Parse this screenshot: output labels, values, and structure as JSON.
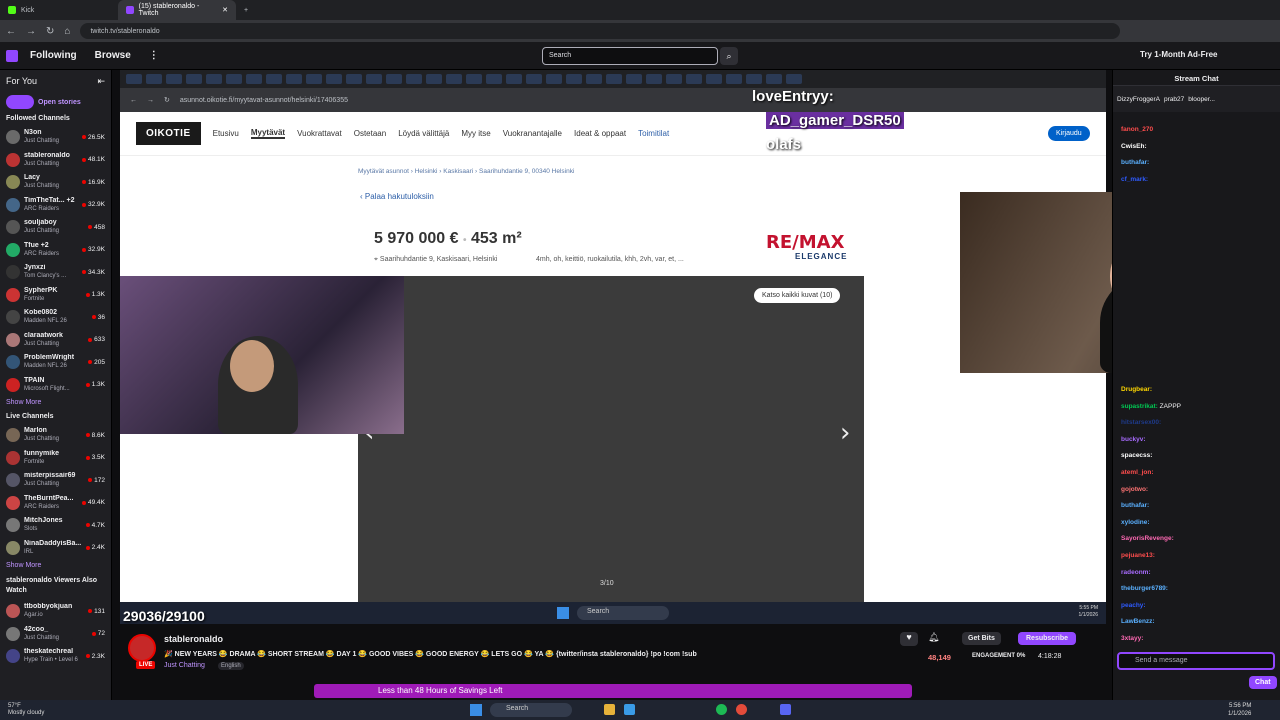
{
  "browser": {
    "tabs": [
      {
        "label": "Kick",
        "active": false,
        "color": "#53fc18"
      },
      {
        "label": "(15) stableronaldo - Twitch",
        "active": true,
        "color": "#9147ff"
      }
    ],
    "url": "twitch.tv/stableronaldo"
  },
  "twitch_nav": {
    "following": "Following",
    "browse": "Browse",
    "search_placeholder": "Search",
    "ad_free": "Try 1-Month Ad-Free"
  },
  "sidebar": {
    "for_you": "For You",
    "open_stories": "Open stories",
    "followed_title": "Followed Channels",
    "followed": [
      {
        "name": "N3on",
        "game": "Just Chatting",
        "viewers": "26.5K",
        "color": "#6a6a6a"
      },
      {
        "name": "stableronaldo",
        "game": "Just Chatting",
        "viewers": "48.1K",
        "color": "#b33"
      },
      {
        "name": "Lacy",
        "game": "Just Chatting",
        "viewers": "16.9K",
        "color": "#885"
      },
      {
        "name": "TimTheTat... +2",
        "game": "ARC Raiders",
        "viewers": "32.9K",
        "color": "#468"
      },
      {
        "name": "souljaboy",
        "game": "Just Chatting",
        "viewers": "458",
        "color": "#555"
      },
      {
        "name": "Tfue +2",
        "game": "ARC Raiders",
        "viewers": "32.9K",
        "color": "#2a6"
      },
      {
        "name": "Jynxzi",
        "game": "Tom Clancy's ...",
        "viewers": "34.3K",
        "color": "#333"
      },
      {
        "name": "SypherPK",
        "game": "Fortnite",
        "viewers": "1.3K",
        "color": "#c33"
      },
      {
        "name": "Kobe0802",
        "game": "Madden NFL 26",
        "viewers": "36",
        "color": "#444"
      },
      {
        "name": "claraatwork",
        "game": "Just Chatting",
        "viewers": "633",
        "color": "#a77"
      },
      {
        "name": "ProblemWright",
        "game": "Madden NFL 26",
        "viewers": "205",
        "color": "#357"
      },
      {
        "name": "TPAIN",
        "game": "Microsoft Flight...",
        "viewers": "1.3K",
        "color": "#c22"
      }
    ],
    "show_more_1": "Show More",
    "live_title": "Live Channels",
    "live": [
      {
        "name": "Marlon",
        "game": "Just Chatting",
        "viewers": "8.6K",
        "color": "#765"
      },
      {
        "name": "funnymike",
        "game": "Fortnite",
        "viewers": "3.5K",
        "color": "#a33"
      },
      {
        "name": "misterpissair69",
        "game": "Just Chatting",
        "viewers": "172",
        "color": "#556"
      },
      {
        "name": "TheBurntPea...",
        "game": "ARC Raiders",
        "viewers": "49.4K",
        "color": "#c44"
      },
      {
        "name": "MitchJones",
        "game": "Slots",
        "viewers": "4.7K",
        "color": "#777"
      },
      {
        "name": "NinaDaddyisBa...",
        "game": "IRL",
        "viewers": "2.4K",
        "color": "#886"
      }
    ],
    "show_more_2": "Show More",
    "viewers_watch_title": "stableronaldo Viewers Also Watch",
    "also_watch": [
      {
        "name": "ttbobbyokjuan",
        "game": "Agar.io",
        "viewers": "131",
        "color": "#b55"
      },
      {
        "name": "42coo_",
        "game": "Just Chatting",
        "viewers": "72",
        "color": "#777"
      },
      {
        "name": "theskatechreal",
        "game": "Hype Train • Level 6",
        "viewers": "2.3K",
        "color": "#448"
      }
    ]
  },
  "stream_page": {
    "inner_url": "asunnot.oikotie.fi/myytavat-asunnot/helsinki/17406355",
    "logo": "OIKOTIE",
    "nav": [
      "Etusivu",
      "Myytävät",
      "Vuokrattavat",
      "Ostetaan",
      "Löydä välittäjä",
      "Myy itse",
      "Vuokranantajalle",
      "Ideat & oppaat",
      "Toimitilat"
    ],
    "login": "Kirjaudu",
    "breadcrumb": "Myytävät asunnot › Helsinki › Kaskisaari › Saarihuhdantie 9, 00340 Helsinki",
    "back": "Palaa hakutuloksiin",
    "price": "5 970 000 €",
    "area": "453 m²",
    "address": "Saarihuhdantie 9, Kaskisaari, Helsinki",
    "rooms": "4mh, oh, keittiö, ruokailutila, khh, 2vh, var, et, ...",
    "agency": "RE/MAX",
    "agency_sub": "ELEGANCE",
    "see_all": "Katso kaikki kuvat (10)",
    "counter": "3/10",
    "inner_search": "Search",
    "inner_time": "5:55 PM",
    "inner_date": "1/1/2026"
  },
  "overlay": {
    "names": [
      "loveEntryy:",
      "AD_gamer_DSR50",
      "olafs"
    ],
    "sub_goal": "29036/29100"
  },
  "stream_info": {
    "streamer": "stableronaldo",
    "live": "LIVE",
    "title": "🎉 NEW YEARS 😂 DRAMA 😂 SHORT STREAM 😂 DAY 1 😂 GOOD VIBES 😂 GOOD ENERGY 😂 LETS GO 😂 YA 😂 {twitter/insta stableronaldo} !po !com !sub",
    "category": "Just Chatting",
    "language": "English",
    "get_bits": "Get Bits",
    "resub": "Resubscribe",
    "viewers": "48,149",
    "engagement": "ENGAGEMENT  0%",
    "uptime": "4:18:28",
    "banner": "Less than 48 Hours of Savings Left"
  },
  "chat": {
    "title": "Stream Chat",
    "top": [
      "DizzyFroggerA",
      "prab27",
      "blooper..."
    ],
    "messages": [
      {
        "user": "fanon_270",
        "color": "#ff4d4d",
        "text": ""
      },
      {
        "user": "CwisEh:",
        "color": "#ffffff",
        "text": ""
      },
      {
        "user": "buthafar:",
        "color": "#5ab0ff",
        "text": ""
      },
      {
        "user": "cf_mark:",
        "color": "#2e5bff",
        "text": ""
      },
      {
        "user": "Drugbear:",
        "color": "#ffd700",
        "text": ""
      },
      {
        "user": "supastrikat:",
        "color": "#00c853",
        "text": "ZAPPP"
      },
      {
        "user": "hitstarsex00:",
        "color": "#1e3a8a",
        "text": ""
      },
      {
        "user": "buckyv:",
        "color": "#a86bff",
        "text": ""
      },
      {
        "user": "spacecss:",
        "color": "#ffffff",
        "text": ""
      },
      {
        "user": "ateml_jon:",
        "color": "#ff4d4d",
        "text": ""
      },
      {
        "user": "gojotwo:",
        "color": "#ff7373",
        "text": ""
      },
      {
        "user": "buthafar:",
        "color": "#5ab0ff",
        "text": ""
      },
      {
        "user": "xylodine:",
        "color": "#5ab0ff",
        "text": ""
      },
      {
        "user": "SayorisRevenge:",
        "color": "#ff69b4",
        "text": ""
      },
      {
        "user": "pejuane13:",
        "color": "#ff4d4d",
        "text": ""
      },
      {
        "user": "radeonm:",
        "color": "#a86bff",
        "text": ""
      },
      {
        "user": "theburger6789:",
        "color": "#5ab0ff",
        "text": ""
      },
      {
        "user": "peachy:",
        "color": "#2e5bff",
        "text": ""
      },
      {
        "user": "LawBenzz:",
        "color": "#5ab0ff",
        "text": ""
      },
      {
        "user": "3xtayy:",
        "color": "#ff69b4",
        "text": ""
      }
    ],
    "input_placeholder": "Send a message",
    "chat_button": "Chat"
  },
  "taskbar": {
    "temp": "57°F",
    "weather": "Mostly cloudy",
    "search": "Search",
    "time": "5:56 PM",
    "date": "1/1/2026"
  }
}
